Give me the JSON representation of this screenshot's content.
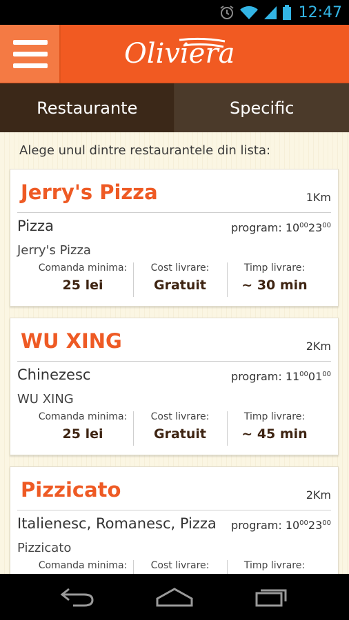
{
  "status": {
    "time": "12:47"
  },
  "app": {
    "logo": "Oliviera"
  },
  "tabs": [
    {
      "label": "Restaurante",
      "active": true
    },
    {
      "label": "Specific",
      "active": false
    }
  ],
  "intro": "Alege unul dintre restaurantele din lista:",
  "restaurants": [
    {
      "name": "Jerry's Pizza",
      "distance": "1Km",
      "cuisine": "Pizza",
      "program_label": "program:",
      "open": "10",
      "open_min": "00",
      "close": "23",
      "close_min": "00",
      "subtitle": "Jerry's Pizza",
      "min_order_label": "Comanda minima:",
      "min_order": "25 lei",
      "delivery_cost_label": "Cost livrare:",
      "delivery_cost": "Gratuit",
      "delivery_time_label": "Timp livrare:",
      "delivery_time": "~ 30 min"
    },
    {
      "name": "WU XING",
      "distance": "2Km",
      "cuisine": "Chinezesc",
      "program_label": "program:",
      "open": "11",
      "open_min": "00",
      "close": "01",
      "close_min": "00",
      "subtitle": "WU XING",
      "min_order_label": "Comanda minima:",
      "min_order": "25 lei",
      "delivery_cost_label": "Cost livrare:",
      "delivery_cost": "Gratuit",
      "delivery_time_label": "Timp livrare:",
      "delivery_time": "~ 45 min"
    },
    {
      "name": "Pizzicato",
      "distance": "2Km",
      "cuisine": "Italienesc, Romanesc, Pizza",
      "program_label": "program:",
      "open": "10",
      "open_min": "00",
      "close": "23",
      "close_min": "00",
      "subtitle": "Pizzicato",
      "min_order_label": "Comanda minima:",
      "min_order": "",
      "delivery_cost_label": "Cost livrare:",
      "delivery_cost": "",
      "delivery_time_label": "Timp livrare:",
      "delivery_time": ""
    }
  ],
  "colors": {
    "brand": "#f15a22",
    "tab_active": "#3b2818",
    "accent_text": "#ee5a24"
  }
}
